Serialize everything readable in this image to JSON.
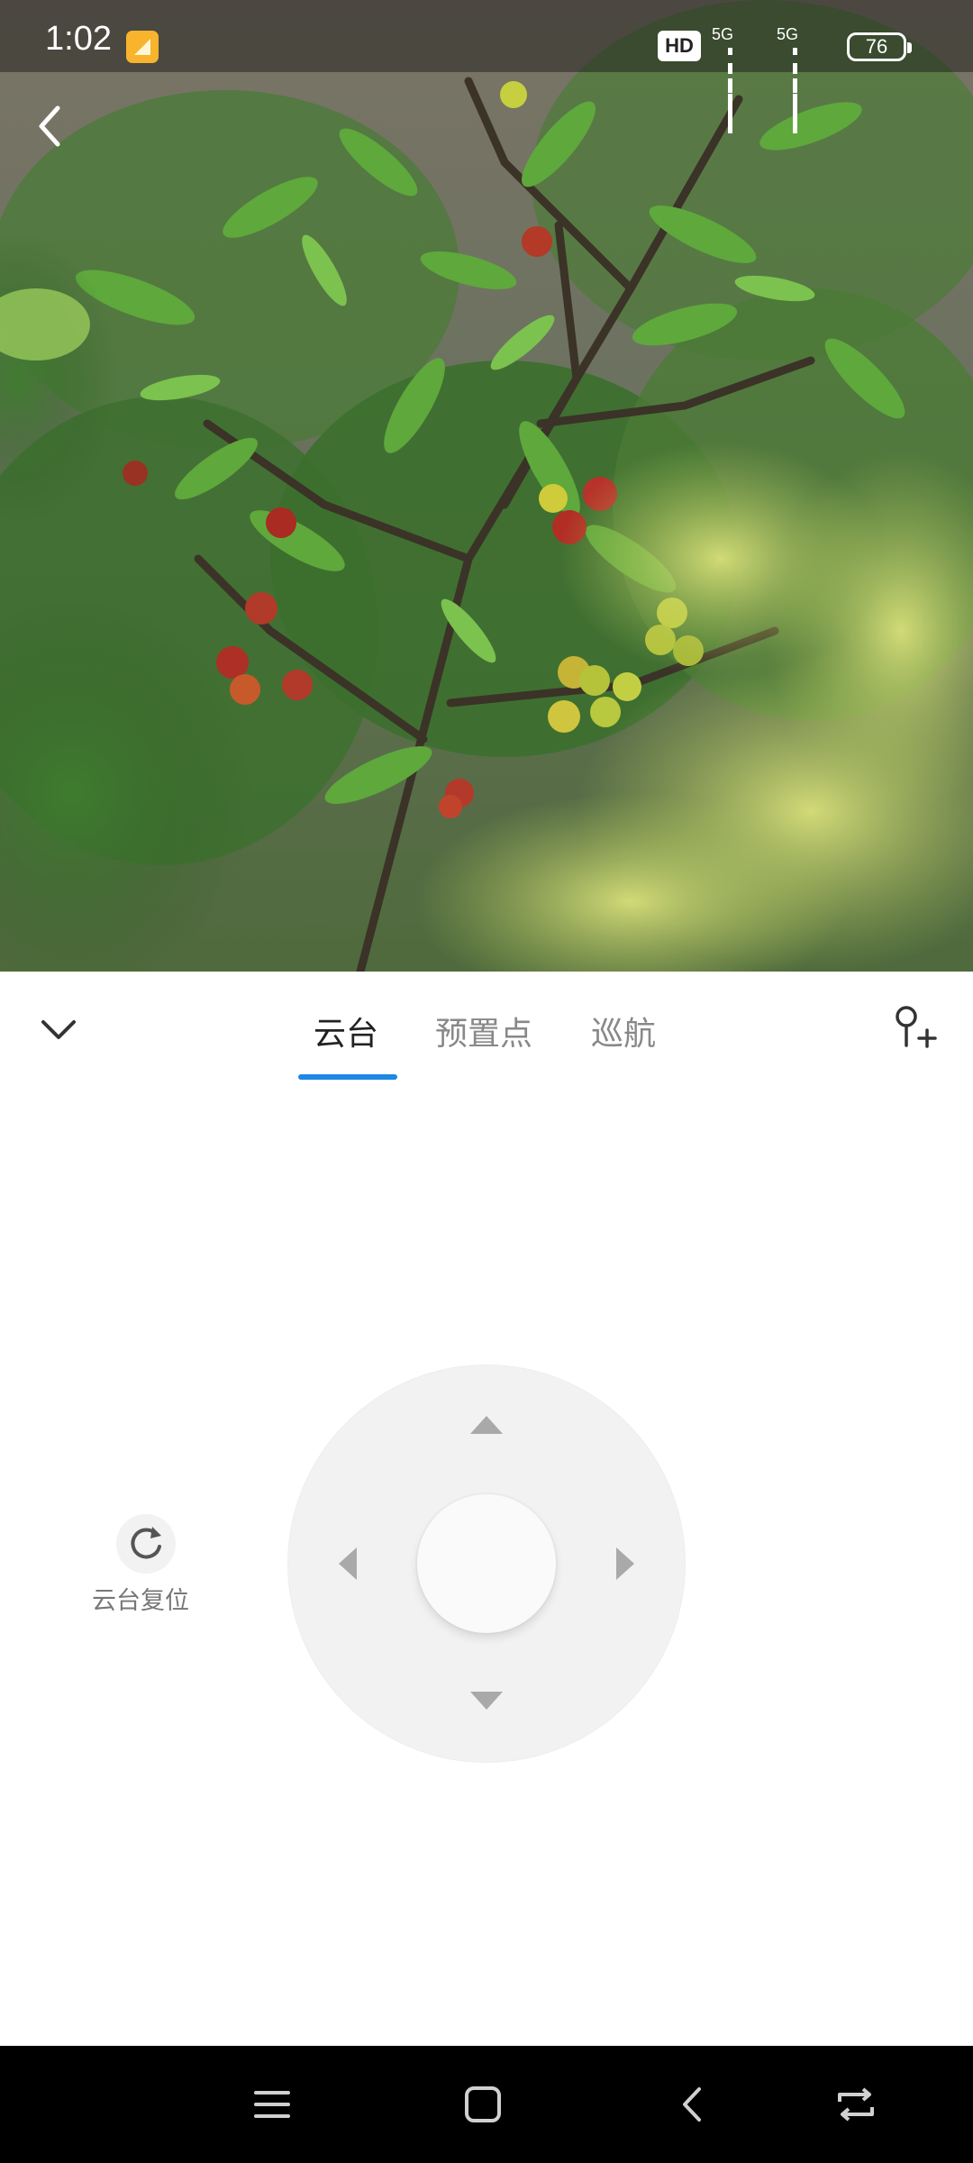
{
  "status_bar": {
    "time": "1:02",
    "hd_label": "HD",
    "signal_1": "5G",
    "signal_2": "5G",
    "battery": "76"
  },
  "tabs": [
    {
      "label": "云台",
      "active": true
    },
    {
      "label": "预置点",
      "active": false
    },
    {
      "label": "巡航",
      "active": false
    }
  ],
  "ptz": {
    "reset_label": "云台复位"
  },
  "colors": {
    "accent": "#1e88e5"
  },
  "icons": {
    "back": "chevron-left-icon",
    "collapse": "chevron-down-icon",
    "add_preset": "pin-add-icon",
    "reset": "rotate-icon",
    "nav_menu": "menu-icon",
    "nav_home": "home-icon",
    "nav_back": "back-icon",
    "nav_switch": "switch-icon"
  }
}
